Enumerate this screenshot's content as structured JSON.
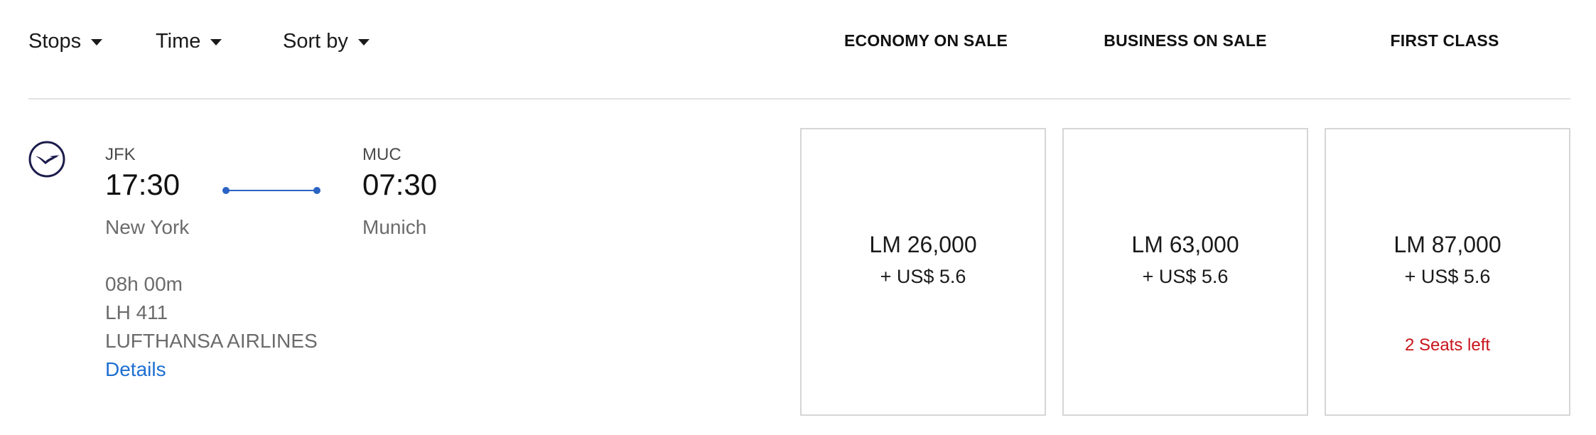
{
  "filters": {
    "stops": "Stops",
    "time": "Time",
    "sort": "Sort by"
  },
  "columns": {
    "economy": "ECONOMY ON SALE",
    "business": "BUSINESS ON SALE",
    "first": "FIRST CLASS"
  },
  "flight": {
    "airline_icon": "lufthansa-crane-icon",
    "origin": {
      "code": "JFK",
      "time": "17:30",
      "city": "New York"
    },
    "destination": {
      "code": "MUC",
      "time": "07:30",
      "city": "Munich"
    },
    "duration": "08h 00m",
    "flight_number": "LH 411",
    "airline": "LUFTHANSA AIRLINES",
    "details_label": "Details"
  },
  "fares": {
    "economy": {
      "miles": "LM 26,000",
      "tax": "+ US$ 5.6"
    },
    "business": {
      "miles": "LM 63,000",
      "tax": "+ US$ 5.6"
    },
    "first": {
      "miles": "LM 87,000",
      "tax": "+ US$ 5.6",
      "seats": "2 Seats left"
    }
  },
  "colors": {
    "accent": "#1f6fd1",
    "route_line": "#2a63c4",
    "warning": "#c8141b",
    "logo": "#1b1c4a"
  }
}
